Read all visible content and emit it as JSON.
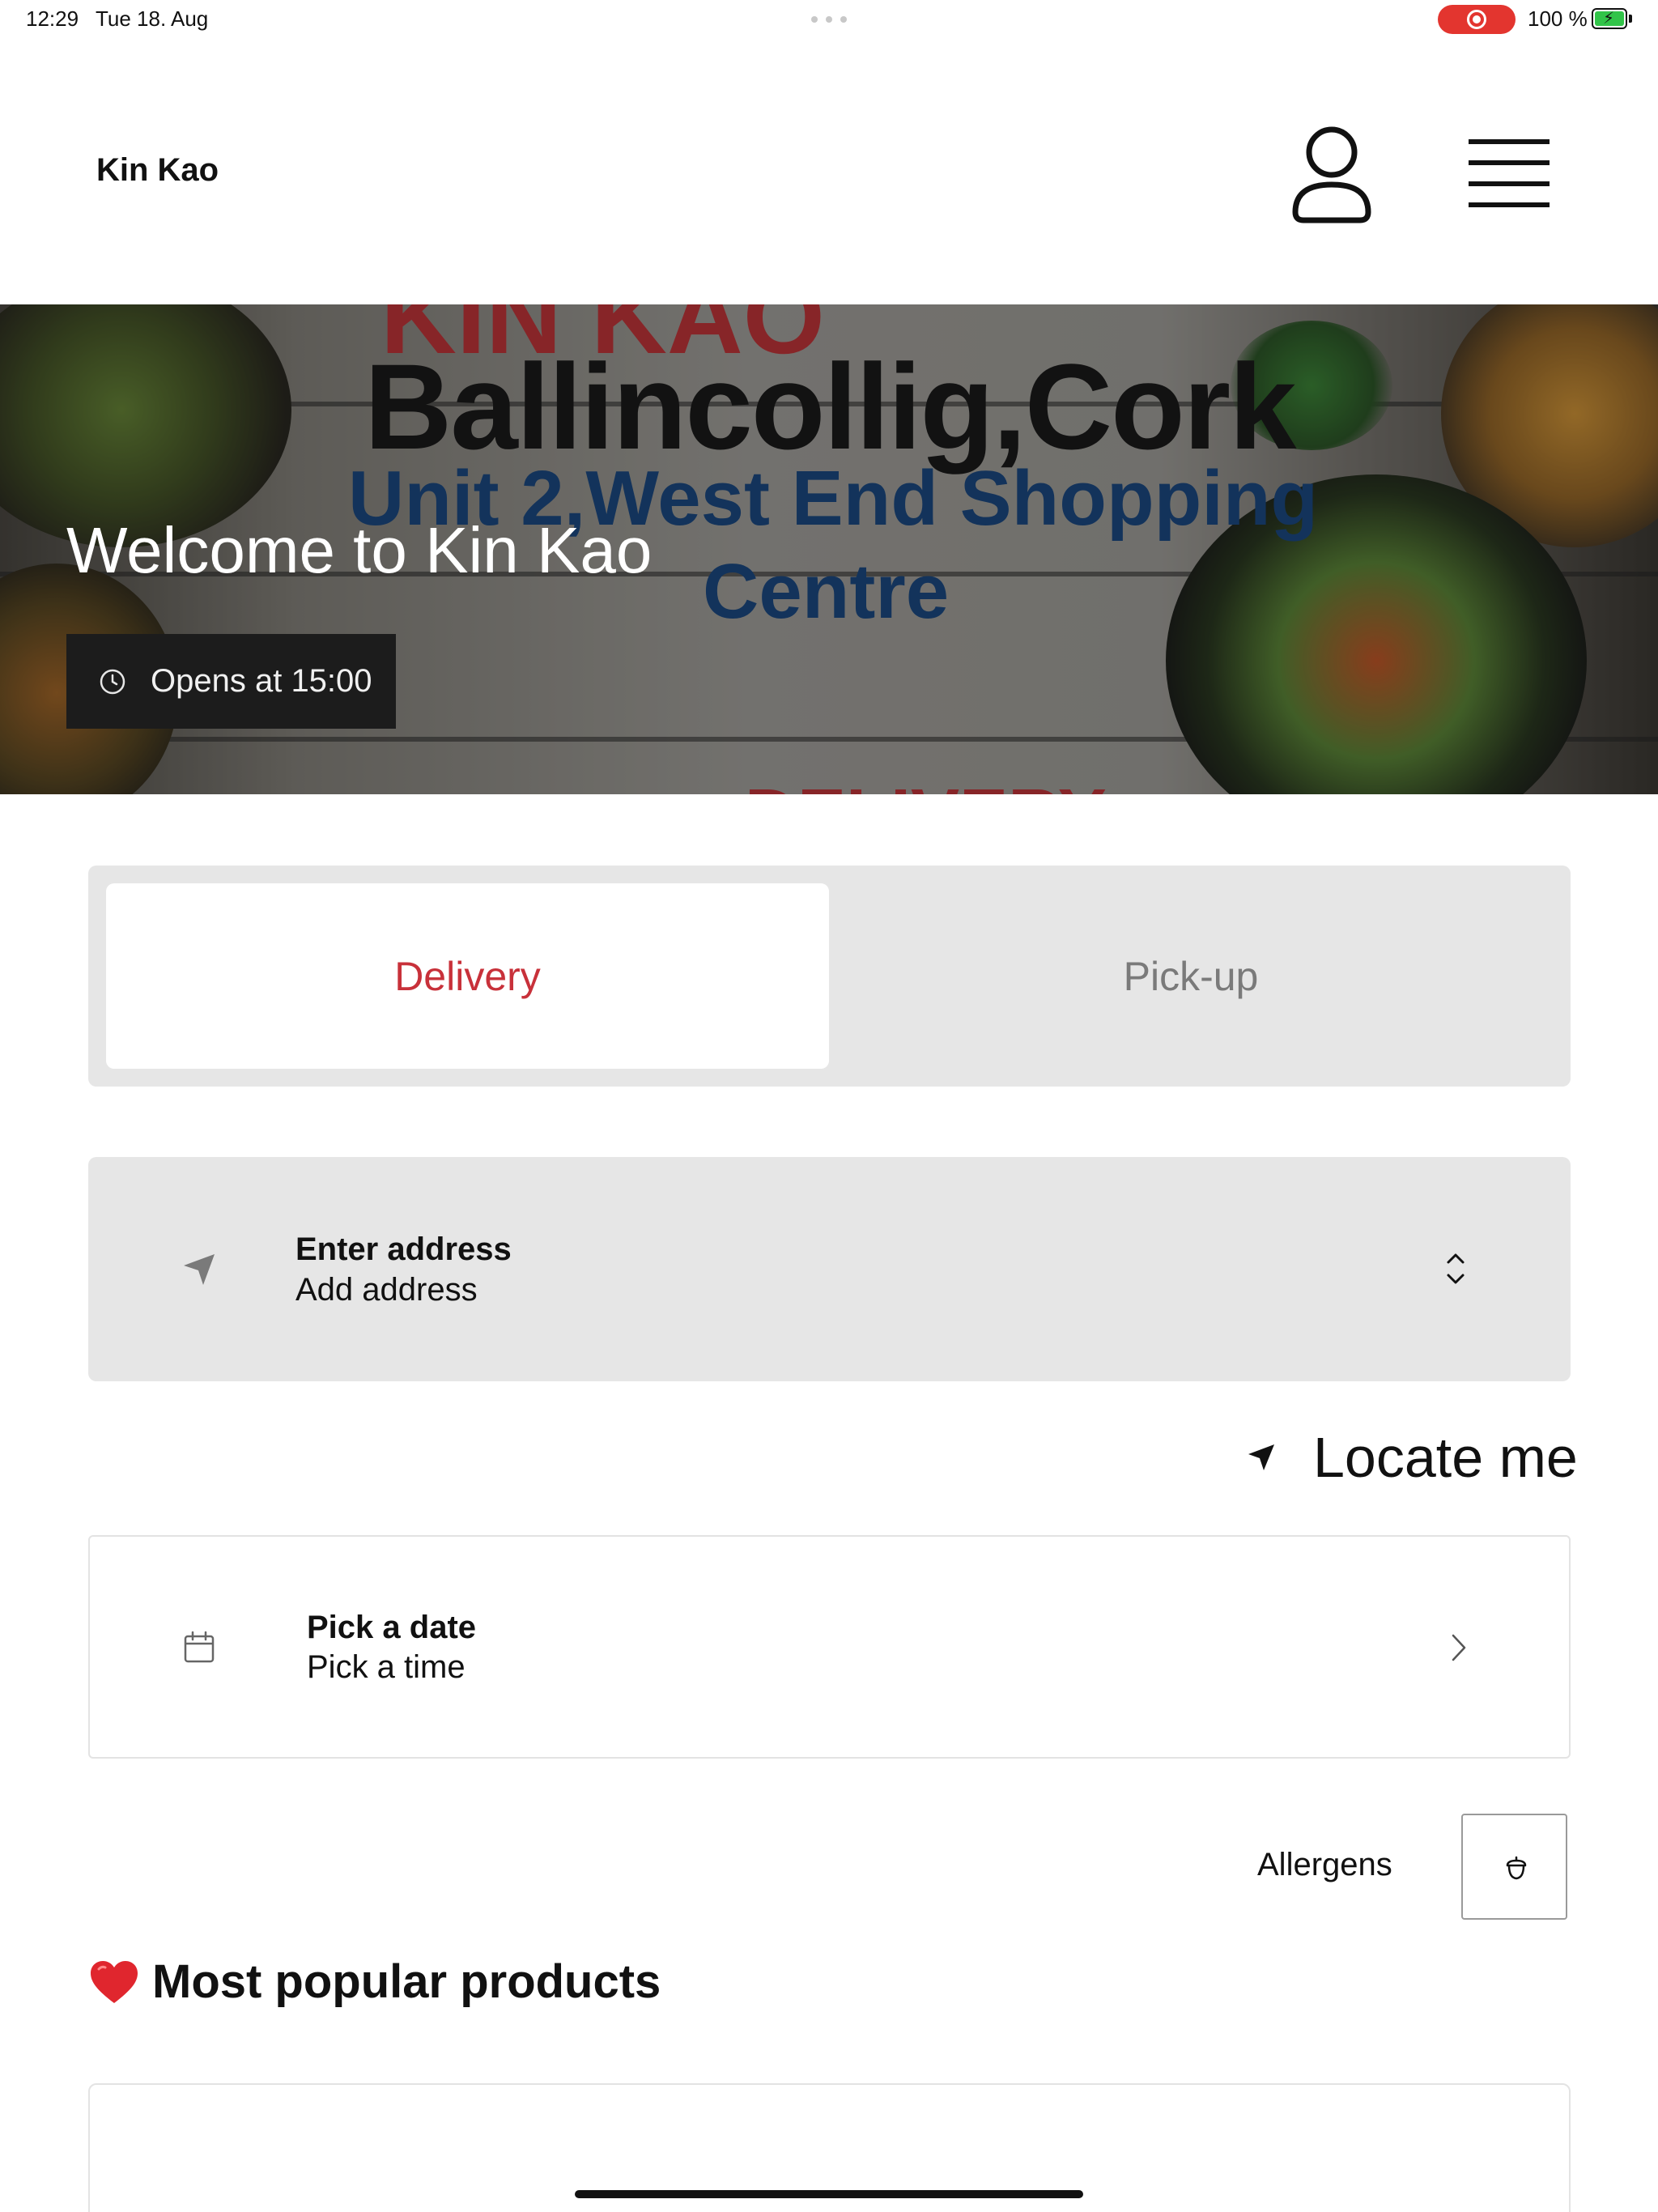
{
  "status_bar": {
    "time": "12:29",
    "date": "Tue 18. Aug",
    "battery_percent": "100 %",
    "recording_color": "#e3352f",
    "battery_color": "#32c449"
  },
  "header": {
    "brand": "Kin Kao",
    "profile_icon": "user-icon",
    "menu_icon": "hamburger-icon"
  },
  "hero": {
    "image_text": {
      "top_red": "KIN KAO",
      "headline": "Ballincollig,Cork",
      "address_line1": "Unit 2,West End Shopping",
      "address_line2": "Centre",
      "bottom_red": "DELIVERY"
    },
    "welcome": "Welcome to Kin Kao",
    "opens_label": "Opens at 15:00"
  },
  "order_mode": {
    "tabs": [
      {
        "label": "Delivery",
        "selected": true
      },
      {
        "label": "Pick-up",
        "selected": false
      }
    ],
    "accent_color": "#c8313a"
  },
  "address": {
    "title": "Enter address",
    "subtitle": "Add address"
  },
  "locate": {
    "label": "Locate me"
  },
  "schedule": {
    "title": "Pick a date",
    "subtitle": "Pick a time"
  },
  "allergens": {
    "label": "Allergens",
    "icon": "acorn-icon"
  },
  "popular": {
    "heading": "Most popular products",
    "emoji": "heart-icon"
  }
}
